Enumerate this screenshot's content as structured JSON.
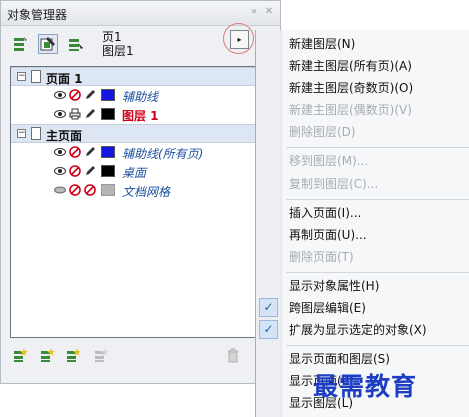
{
  "docker": {
    "title": "对象管理器",
    "current_page": "页1",
    "current_layer": "图层1",
    "flyout_arrow": "▸",
    "title_buttons": [
      "»",
      "✕"
    ],
    "icons": [
      "show-object-properties-icon",
      "cross-layer-edit-icon",
      "layer-manager-view-icon",
      "new-layer-icon",
      "new-master-layer-icon",
      "delete-layer-icon"
    ]
  },
  "tree": {
    "pages": [
      {
        "label": "页面 1",
        "expander": "⊟",
        "layers": [
          {
            "name": "辅助线",
            "color": "#1515e0",
            "name_color": "#1b4f9c",
            "printable": false,
            "bold": false
          },
          {
            "name": "图层 1",
            "color": "#000000",
            "name_color": "#d0021b",
            "printable": true,
            "bold": true
          }
        ]
      },
      {
        "label": "主页面",
        "expander": "⊟",
        "layers": [
          {
            "name": "辅助线(所有页)",
            "color": "#1515e0",
            "name_color": "#1b4f9c",
            "printable": false,
            "bold": false
          },
          {
            "name": "桌面",
            "color": "#000000",
            "name_color": "#1b4f9c",
            "printable": false,
            "bold": false
          },
          {
            "name": "文档网格",
            "color": "#b5b5b5",
            "name_color": "#1b4f9c",
            "printable": false,
            "bold": false
          }
        ]
      }
    ]
  },
  "menu": {
    "items": [
      {
        "label": "新建图层(N)",
        "disabled": false
      },
      {
        "label": "新建主图层(所有页)(A)",
        "disabled": false
      },
      {
        "label": "新建主图层(奇数页)(O)",
        "disabled": false
      },
      {
        "label": "新建主图层(偶数页)(V)",
        "disabled": true
      },
      {
        "label": "删除图层(D)",
        "disabled": true
      },
      {
        "label": "移到图层(M)...",
        "disabled": true
      },
      {
        "label": "复制到图层(C)...",
        "disabled": true
      },
      {
        "label": "插入页面(I)...",
        "disabled": false
      },
      {
        "label": "再制页面(U)...",
        "disabled": false
      },
      {
        "label": "删除页面(T)",
        "disabled": true
      },
      {
        "label": "显示对象属性(H)",
        "disabled": false,
        "checked": false
      },
      {
        "label": "跨图层编辑(E)",
        "disabled": false,
        "checked": true
      },
      {
        "label": "扩展为显示选定的对象(X)",
        "disabled": false,
        "checked": true
      },
      {
        "label": "显示页面和图层(S)",
        "disabled": false
      },
      {
        "label": "显示页面(P)",
        "disabled": false
      },
      {
        "label": "显示图层(L)",
        "disabled": false
      }
    ],
    "check_glyph": "✓"
  },
  "watermark": "最需教育"
}
